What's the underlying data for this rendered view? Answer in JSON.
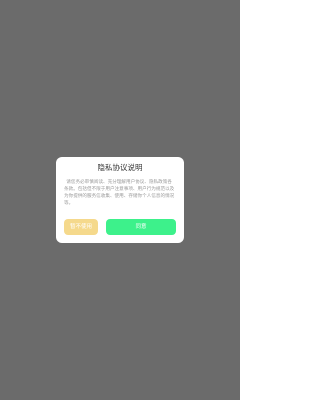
{
  "dialog": {
    "title": "隐私协议说明",
    "body": "请您务必审慎阅读、充分理解用户协议、隐私政策各条款。包括但不限于用户注意事项、用户行为规范以及为你提供的服务信收集、使用、存储你个人信息的情况等。",
    "disagree_label": "暂不使用",
    "agree_label": "同意"
  },
  "colors": {
    "overlay": "#6b6b6b",
    "dialog_bg": "#ffffff",
    "disagree_button": "#f5d98c",
    "agree_button": "#3df18b"
  }
}
